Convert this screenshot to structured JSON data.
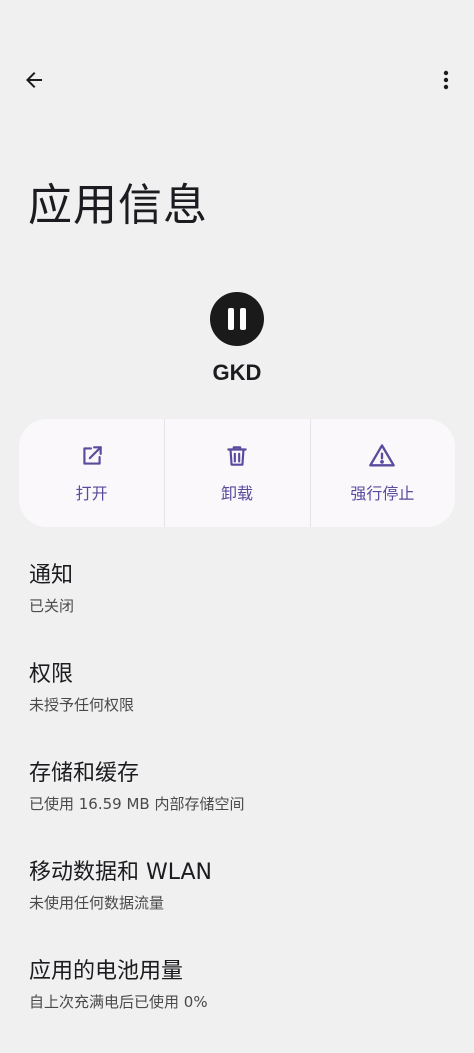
{
  "header": {
    "back_icon": "arrow-back-icon",
    "more_icon": "more-vert-icon",
    "title": "应用信息"
  },
  "app": {
    "icon": "pause-icon",
    "name": "GKD"
  },
  "actions": [
    {
      "label": "打开",
      "icon": "open-external-icon"
    },
    {
      "label": "卸载",
      "icon": "trash-icon"
    },
    {
      "label": "强行停止",
      "icon": "warning-icon"
    }
  ],
  "accent_color": "#5b4a9e",
  "items": [
    {
      "title": "通知",
      "subtitle": "已关闭"
    },
    {
      "title": "权限",
      "subtitle": "未授予任何权限"
    },
    {
      "title": "存储和缓存",
      "subtitle": "已使用 16.59 MB 内部存储空间"
    },
    {
      "title": "移动数据和 WLAN",
      "subtitle": "未使用任何数据流量"
    },
    {
      "title": "应用的电池用量",
      "subtitle": "自上次充满电后已使用 0%"
    }
  ]
}
